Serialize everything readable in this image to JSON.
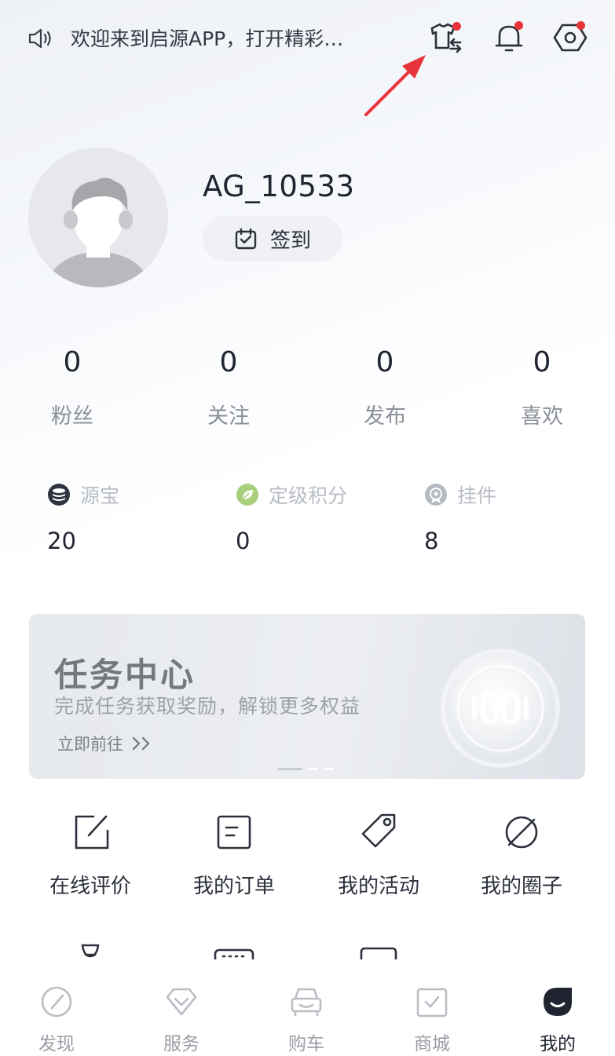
{
  "header": {
    "notice_text": "欢迎来到启源APP，打开精彩…",
    "icons": [
      "speaker-icon",
      "shirt-swap-icon",
      "bell-icon",
      "settings-hex-icon"
    ],
    "badge_color": "#e8333a",
    "annotation_color": "#e8333a"
  },
  "profile": {
    "username": "AG_10533",
    "checkin_label": "签到"
  },
  "stats": [
    {
      "value": "0",
      "label": "粉丝"
    },
    {
      "value": "0",
      "label": "关注"
    },
    {
      "value": "0",
      "label": "发布"
    },
    {
      "value": "0",
      "label": "喜欢"
    }
  ],
  "wallet": [
    {
      "label": "源宝",
      "value": "20",
      "icon": "coin-stack-icon"
    },
    {
      "label": "定级积分",
      "value": "0",
      "icon": "leaf-badge-icon"
    },
    {
      "label": "挂件",
      "value": "8",
      "icon": "medal-icon"
    }
  ],
  "banner": {
    "title": "任务中心",
    "subtitle": "完成任务获取奖励，解锁更多权益",
    "link": "立即前往"
  },
  "menu": [
    {
      "label": "在线评价",
      "icon": "edit-icon"
    },
    {
      "label": "我的订单",
      "icon": "order-icon"
    },
    {
      "label": "我的活动",
      "icon": "tag-icon"
    },
    {
      "label": "我的圈子",
      "icon": "circle-icon"
    }
  ],
  "tabs": [
    {
      "label": "发现",
      "icon": "compass-icon",
      "active": false
    },
    {
      "label": "服务",
      "icon": "diamond-icon",
      "active": false
    },
    {
      "label": "购车",
      "icon": "car-icon",
      "active": false
    },
    {
      "label": "商城",
      "icon": "shop-icon",
      "active": false
    },
    {
      "label": "我的",
      "icon": "profile-icon",
      "active": true
    }
  ],
  "colors": {
    "tab_active": "#1f2430",
    "tab_inactive": "#9a9ea6",
    "leaf_green": "#a9cf7c"
  }
}
